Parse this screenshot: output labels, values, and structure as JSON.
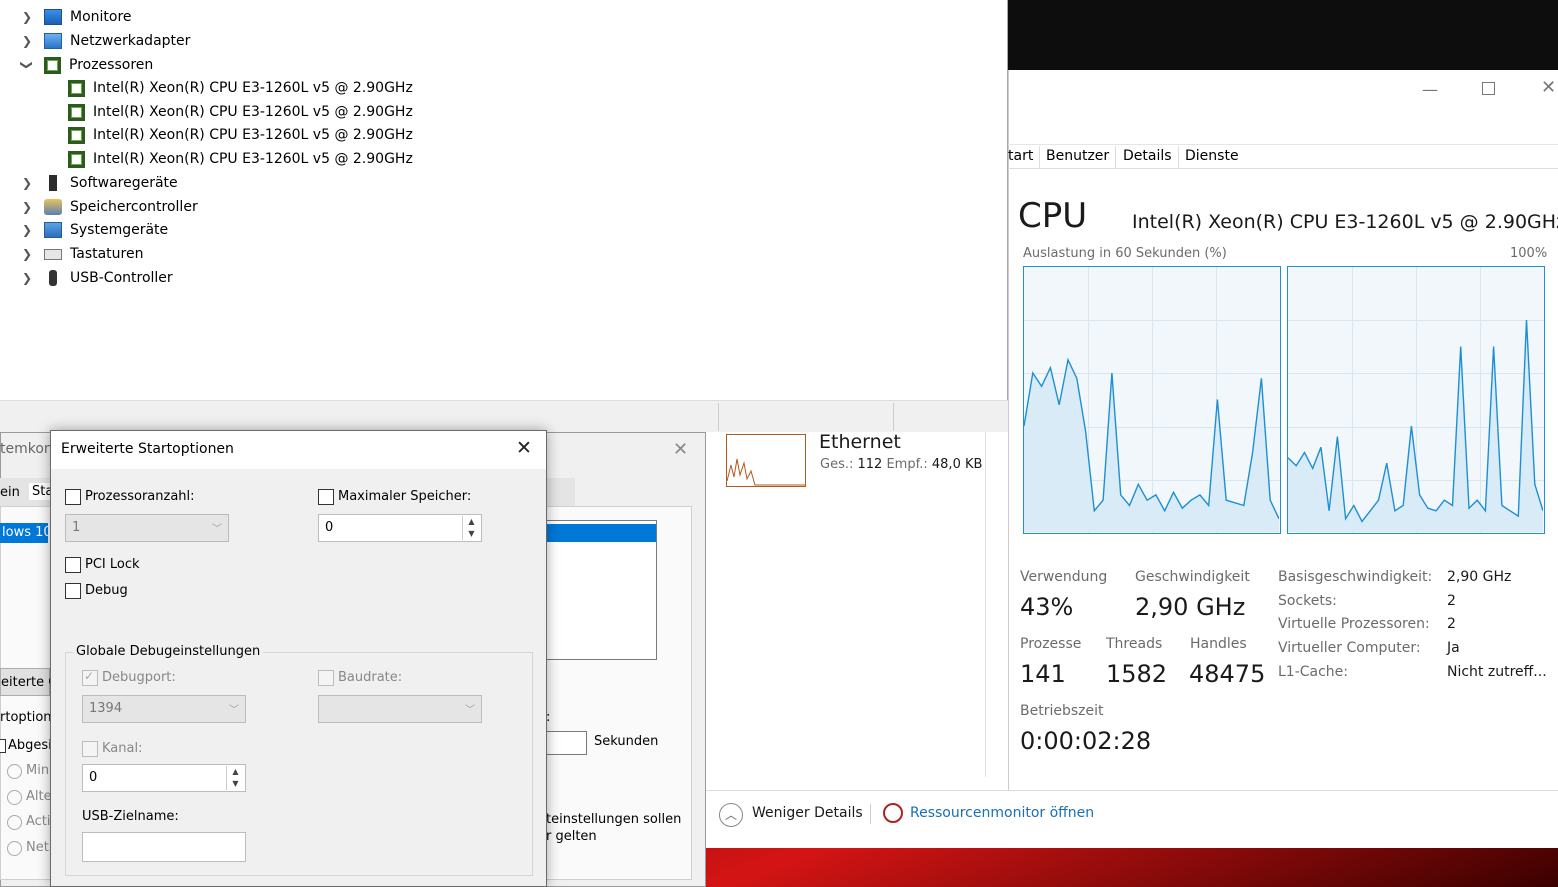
{
  "device_manager": {
    "items": [
      {
        "label": "Monitore",
        "expanded": false,
        "icon": "monitor-icon"
      },
      {
        "label": "Netzwerkadapter",
        "expanded": false,
        "icon": "network-adapter-icon"
      },
      {
        "label": "Prozessoren",
        "expanded": true,
        "icon": "processor-icon"
      },
      {
        "label": "Softwaregeräte",
        "expanded": false,
        "icon": "software-device-icon"
      },
      {
        "label": "Speichercontroller",
        "expanded": false,
        "icon": "storage-controller-icon"
      },
      {
        "label": "Systemgeräte",
        "expanded": false,
        "icon": "system-device-icon"
      },
      {
        "label": "Tastaturen",
        "expanded": false,
        "icon": "keyboard-icon"
      },
      {
        "label": "USB-Controller",
        "expanded": false,
        "icon": "usb-icon"
      }
    ],
    "processors": [
      "Intel(R) Xeon(R) CPU E3-1260L v5 @ 2.90GHz",
      "Intel(R) Xeon(R) CPU E3-1260L v5 @ 2.90GHz",
      "Intel(R) Xeon(R) CPU E3-1260L v5 @ 2.90GHz",
      "Intel(R) Xeon(R) CPU E3-1260L v5 @ 2.90GHz"
    ]
  },
  "msconfig": {
    "title_partial": "temkon",
    "tabs_partial": [
      "ein",
      "Sta"
    ],
    "selected_item_partial": "lows 10",
    "advanced_button_partial": "eiterte C",
    "startoptions_partial": "rtoption",
    "safe_boot_partial": "Abgesi",
    "radio_partials": [
      "Mini",
      "Alte",
      "Acti",
      "Net"
    ],
    "timeout_suffix_colon": ":",
    "timeout_unit": "Sekunden",
    "note_line1": "teinstellungen sollen",
    "note_line2": "r gelten"
  },
  "dialog": {
    "title": "Erweiterte Startoptionen",
    "processor_count_label": "Prozessoranzahl:",
    "processor_count_value": "1",
    "max_memory_label": "Maximaler Speicher:",
    "max_memory_value": "0",
    "pci_lock_label": "PCI Lock",
    "debug_label": "Debug",
    "global_debug_group": "Globale Debugeinstellungen",
    "debugport_label": "Debugport:",
    "debugport_value": "1394",
    "baudrate_label": "Baudrate:",
    "baudrate_value": "",
    "channel_label": "Kanal:",
    "channel_value": "0",
    "usb_target_label": "USB-Zielname:",
    "usb_target_value": ""
  },
  "task_manager": {
    "tabs": [
      "tart",
      "Benutzer",
      "Details",
      "Dienste"
    ],
    "title": "CPU",
    "cpu_name": "Intel(R) Xeon(R) CPU E3-1260L v5 @ 2.90GHz",
    "graph_label": "Auslastung in 60 Sekunden (%)",
    "graph_max": "100%",
    "usage_label": "Verwendung",
    "usage_value": "43%",
    "speed_label": "Geschwindigkeit",
    "speed_value": "2,90 GHz",
    "processes_label": "Prozesse",
    "processes_value": "141",
    "threads_label": "Threads",
    "threads_value": "1582",
    "handles_label": "Handles",
    "handles_value": "48475",
    "uptime_label": "Betriebszeit",
    "uptime_value": "0:00:02:28",
    "specs": [
      {
        "key": "Basisgeschwindigkeit:",
        "value": "2,90 GHz"
      },
      {
        "key": "Sockets:",
        "value": "2"
      },
      {
        "key": "Virtuelle Prozessoren:",
        "value": "2"
      },
      {
        "key": "Virtueller Computer:",
        "value": "Ja"
      },
      {
        "key": "L1-Cache:",
        "value": "Nicht zutreff..."
      }
    ],
    "ethernet": {
      "name": "Ethernet",
      "prefix_sent": "Ges.:",
      "sent": "112",
      "prefix_recv": "Empf.:",
      "recv": "48,0 KB"
    },
    "fewer_details": "Weniger Details",
    "resource_monitor": "Ressourcenmonitor öffnen",
    "accent": "#1e8fd3"
  },
  "chart_data": [
    {
      "type": "line",
      "series": [
        {
          "values": [
            40,
            60,
            55,
            62,
            48,
            65,
            58,
            38,
            8,
            12,
            60,
            14,
            10,
            18,
            12,
            14,
            8,
            15,
            9,
            12,
            14,
            10,
            50,
            12,
            11,
            10,
            30,
            58,
            12,
            5
          ]
        }
      ],
      "ylim": [
        0,
        100
      ]
    },
    {
      "type": "line",
      "series": [
        {
          "values": [
            28,
            25,
            30,
            24,
            32,
            8,
            36,
            5,
            10,
            4,
            8,
            12,
            26,
            8,
            10,
            40,
            14,
            9,
            8,
            12,
            10,
            70,
            9,
            12,
            8,
            70,
            10,
            8,
            6,
            80,
            18,
            8
          ]
        }
      ],
      "ylim": [
        0,
        100
      ]
    }
  ]
}
